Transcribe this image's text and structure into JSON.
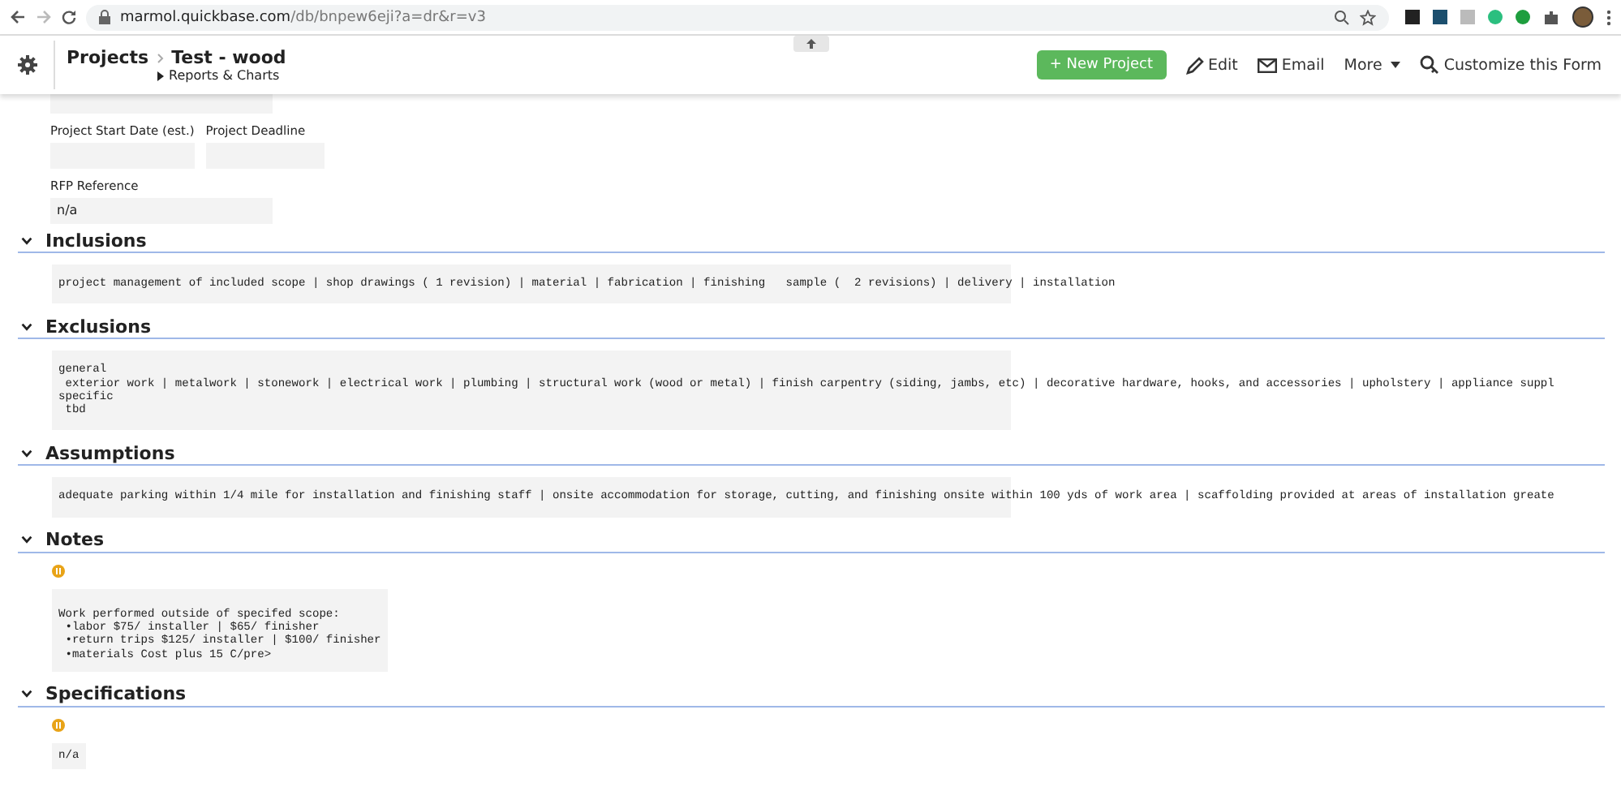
{
  "browser": {
    "url_host": "marmol.quickbase.com",
    "url_path": "/db/bnpew6eji?a=dr&r=v3"
  },
  "header": {
    "table": "Projects",
    "record": "Test - wood",
    "menu": "Reports & Charts",
    "new_button": "+ New Project",
    "actions": [
      {
        "kind": "edit",
        "label": "Edit"
      },
      {
        "kind": "email",
        "label": "Email"
      },
      {
        "kind": "more",
        "label": "More"
      },
      {
        "kind": "customize",
        "label": "Customize this Form"
      }
    ]
  },
  "field_rows": [
    [
      {
        "label": "Project Start Date (est.)"
      },
      {
        "label": "Project Deadline"
      }
    ],
    [
      {
        "label": "RFP Reference",
        "value": "n/a"
      }
    ]
  ],
  "sections": [
    {
      "title": "Inclusions",
      "expanded": true,
      "alert": false,
      "wide": true,
      "lines": [
        "project management of included scope | shop drawings ( 1 revision) | material | fabrication | finishing   sample (  2 revisions) | delivery | installation"
      ]
    },
    {
      "title": "Exclusions",
      "expanded": true,
      "alert": false,
      "wide": true,
      "lines": [
        "general",
        " exterior work | metalwork | stonework | electrical work | plumbing | structural work (wood or metal) | finish carpentry (siding, jambs, etc) | decorative hardware, hooks, and accessories | upholstery | appliance suppl",
        "specific",
        " tbd"
      ]
    },
    {
      "title": "Assumptions",
      "expanded": true,
      "alert": false,
      "wide": true,
      "lines": [
        "adequate parking within 1/4 mile for installation and finishing staff | onsite accommodation for storage, cutting, and finishing onsite within 100 yds of work area | scaffolding provided at areas of installation greate"
      ]
    },
    {
      "title": "Notes",
      "expanded": true,
      "alert": true,
      "wide": false,
      "lines": [
        "Work performed outside of specifed scope:",
        " •labor $75/ installer | $65/ finisher",
        " •return trips $125/ installer | $100/ finisher",
        " •materials Cost plus 15 C/pre>"
      ]
    },
    {
      "title": "Specifications",
      "expanded": true,
      "alert": true,
      "wide": false,
      "lines": [
        "n/a"
      ]
    }
  ]
}
